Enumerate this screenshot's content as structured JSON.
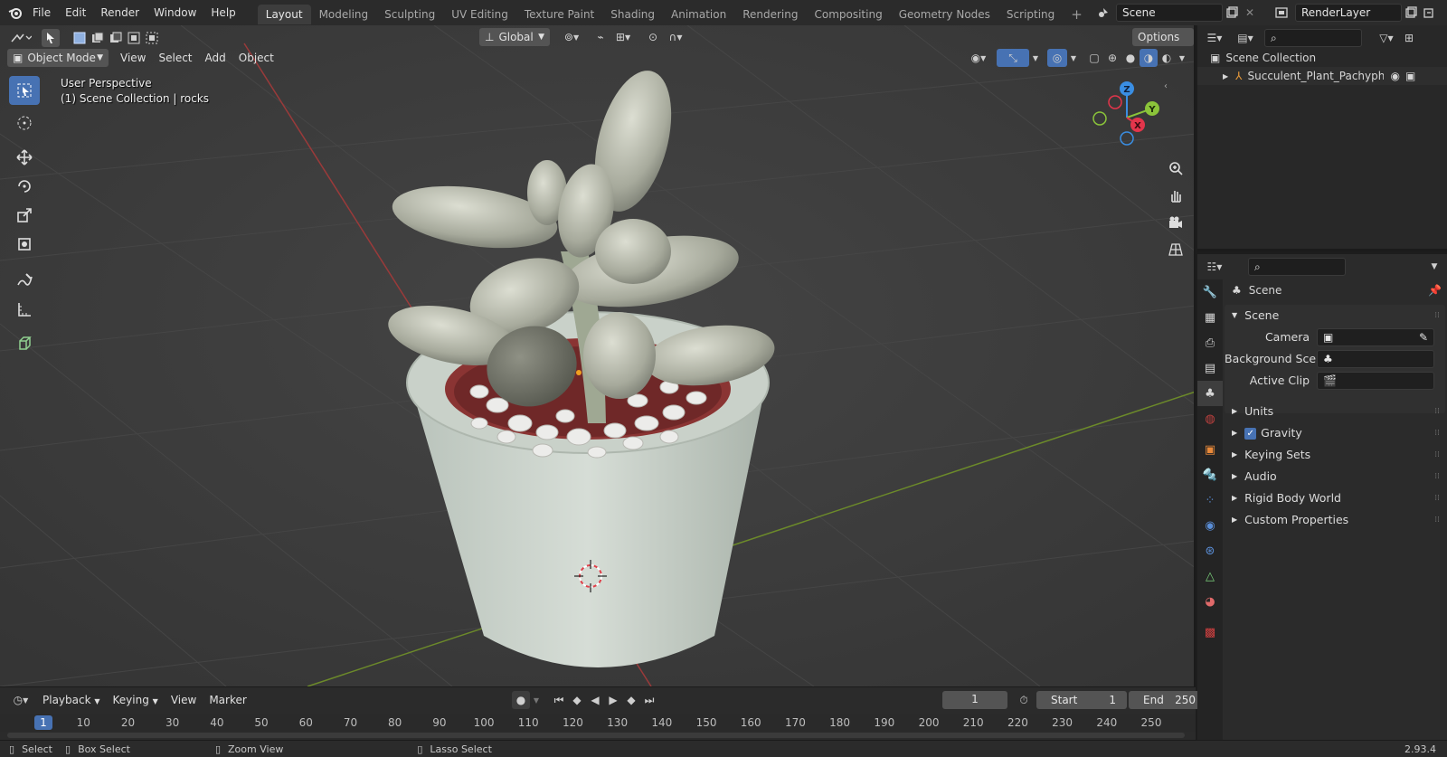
{
  "menu": [
    "File",
    "Edit",
    "Render",
    "Window",
    "Help"
  ],
  "workspaces": [
    "Layout",
    "Modeling",
    "Sculpting",
    "UV Editing",
    "Texture Paint",
    "Shading",
    "Animation",
    "Rendering",
    "Compositing",
    "Geometry Nodes",
    "Scripting"
  ],
  "active_workspace": "Layout",
  "scene_field": "Scene",
  "render_layer_field": "RenderLayer",
  "viewport": {
    "transform_orientation": "Global",
    "options_label": "Options",
    "mode": "Object Mode",
    "menus": [
      "View",
      "Select",
      "Add",
      "Object"
    ],
    "overlay_title": "User Perspective",
    "overlay_subtitle": "(1) Scene Collection | rocks",
    "gizmo_axes": {
      "z": "Z",
      "y": "Y",
      "x": "X"
    }
  },
  "timeline": {
    "menus": [
      "Playback",
      "Keying",
      "View",
      "Marker"
    ],
    "current_frame": "1",
    "start_label": "Start",
    "start_value": "1",
    "end_label": "End",
    "end_value": "250",
    "ticks": [
      "1",
      "10",
      "20",
      "30",
      "40",
      "50",
      "60",
      "70",
      "80",
      "90",
      "100",
      "110",
      "120",
      "130",
      "140",
      "150",
      "160",
      "170",
      "180",
      "190",
      "200",
      "210",
      "220",
      "230",
      "240",
      "250"
    ]
  },
  "status": {
    "select": "Select",
    "box_select": "Box Select",
    "zoom_view": "Zoom View",
    "lasso_select": "Lasso Select",
    "version": "2.93.4"
  },
  "outliner": {
    "root": "Scene Collection",
    "items": [
      "Succulent_Plant_Pachyphytum"
    ]
  },
  "properties": {
    "header_title": "Scene",
    "section_title": "Scene",
    "fields": [
      {
        "label": "Camera",
        "value": ""
      },
      {
        "label": "Background Sce...",
        "value": ""
      },
      {
        "label": "Active Clip",
        "value": ""
      }
    ],
    "subpanels": [
      "Units",
      "Gravity",
      "Keying Sets",
      "Audio",
      "Rigid Body World",
      "Custom Properties"
    ],
    "gravity_checked": true
  },
  "colors": {
    "accent": "#4772b3",
    "axis_x": "#e3354b",
    "axis_y": "#8bc43a",
    "axis_z": "#3a8ee3",
    "x_line": "#9a3a3a",
    "y_line": "#6c8a2a"
  }
}
